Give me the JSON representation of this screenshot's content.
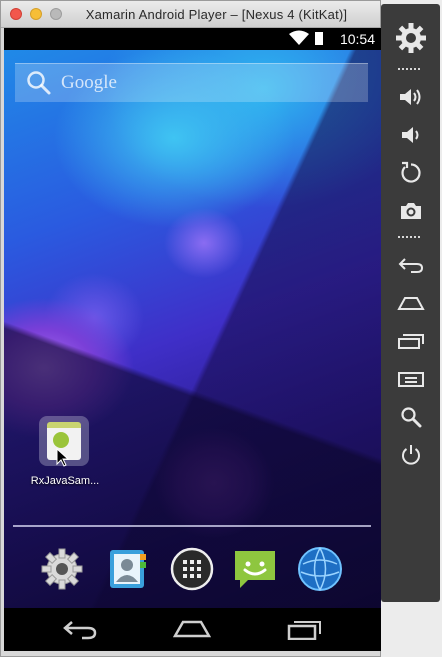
{
  "window": {
    "title": "Xamarin Android Player – [Nexus 4 (KitKat)]"
  },
  "status_bar": {
    "time": "10:54",
    "icons": [
      "wifi-icon",
      "battery-icon"
    ]
  },
  "search_widget": {
    "label": "Google",
    "icon": "search-icon"
  },
  "home_apps": [
    {
      "label": "RxJavaSam...",
      "icon": "app-icon"
    }
  ],
  "dock": [
    {
      "name": "settings",
      "icon": "gear-icon"
    },
    {
      "name": "contacts",
      "icon": "contacts-icon"
    },
    {
      "name": "all-apps",
      "icon": "app-drawer-icon"
    },
    {
      "name": "messaging",
      "icon": "messaging-icon"
    },
    {
      "name": "browser",
      "icon": "globe-icon"
    }
  ],
  "nav_bar": [
    "back-icon",
    "home-icon",
    "recents-icon"
  ],
  "sidebar": {
    "buttons": [
      {
        "name": "settings",
        "icon": "gear-icon"
      },
      {
        "name": "volume-up",
        "icon": "volume-up-icon"
      },
      {
        "name": "volume-down",
        "icon": "volume-down-icon"
      },
      {
        "name": "rotate",
        "icon": "rotate-icon"
      },
      {
        "name": "screenshot",
        "icon": "camera-icon"
      },
      {
        "name": "back",
        "icon": "back-icon"
      },
      {
        "name": "home",
        "icon": "home-icon"
      },
      {
        "name": "recents",
        "icon": "recents-icon"
      },
      {
        "name": "menu",
        "icon": "menu-icon"
      },
      {
        "name": "search",
        "icon": "search-icon"
      },
      {
        "name": "power",
        "icon": "power-icon"
      }
    ]
  },
  "colors": {
    "sidebar_bg": "#3b3b3b",
    "status_bg": "#000000",
    "accent_blue": "#2fb6f0",
    "accent_purple": "#7a3fd8"
  }
}
